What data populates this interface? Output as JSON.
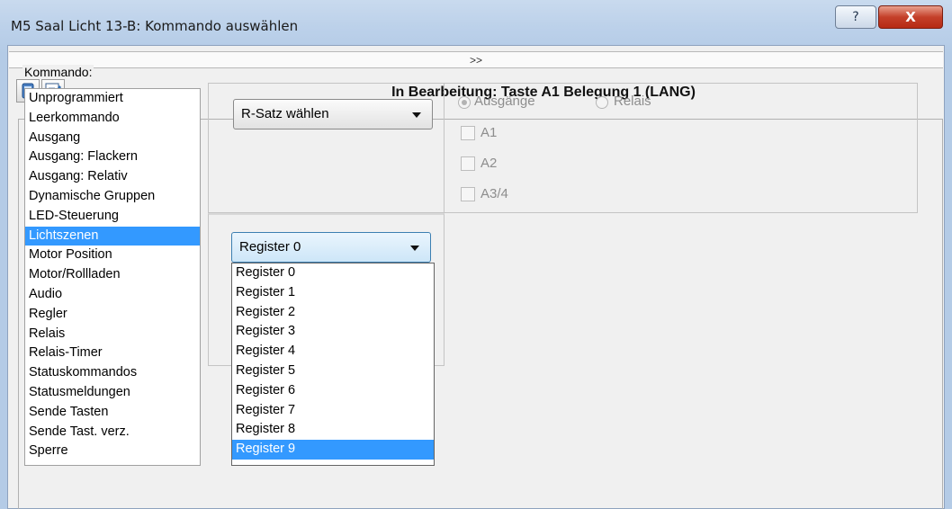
{
  "window": {
    "title": "M5 Saal Licht 13-B: Kommando auswählen",
    "help_glyph": "?",
    "close_glyph": "X"
  },
  "expand_bar": {
    "label": ">>"
  },
  "toolbar": {
    "status_title": "In Bearbeitung: Taste A1 Belegung 1 (LANG)",
    "icons": [
      "tool-icon",
      "edit-note-icon"
    ]
  },
  "kommando": {
    "legend": "Kommando:",
    "items": [
      "Unprogrammiert",
      "Leerkommando",
      "Ausgang",
      "Ausgang: Flackern",
      "Ausgang: Relativ",
      "Dynamische Gruppen",
      "LED-Steuerung",
      "Lichtszenen",
      "Motor Position",
      "Motor/Rollladen",
      "Audio",
      "Regler",
      "Relais",
      "Relais-Timer",
      "Statuskommandos",
      "Statusmeldungen",
      "Sende Tasten",
      "Sende Tast. verz.",
      "Sperre"
    ],
    "selected": "Lichtszenen"
  },
  "rsatz": {
    "value": "R-Satz wählen"
  },
  "options": {
    "radio_ausgaenge": "Ausgänge",
    "radio_relais": "Relais",
    "checkboxes": [
      "A1",
      "A2",
      "A3/4"
    ]
  },
  "register": {
    "value": "Register 0",
    "options": [
      "Register 0",
      "Register 1",
      "Register 2",
      "Register 3",
      "Register 4",
      "Register 5",
      "Register 6",
      "Register 7",
      "Register 8",
      "Register 9"
    ],
    "highlighted": "Register 9"
  },
  "colors": {
    "selection": "#3399ff",
    "title_bar": "#bcd1ea",
    "close_button": "#c4402a"
  }
}
